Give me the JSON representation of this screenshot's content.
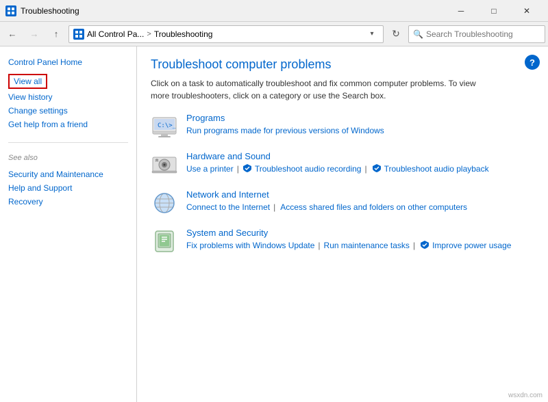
{
  "titleBar": {
    "title": "Troubleshooting",
    "minimizeLabel": "─",
    "maximizeLabel": "□",
    "closeLabel": "✕"
  },
  "addressBar": {
    "backTooltip": "Back",
    "forwardTooltip": "Forward",
    "upTooltip": "Up",
    "pathShort": "All Control Pa...",
    "pathSep": ">",
    "current": "Troubleshooting",
    "refreshLabel": "⟳",
    "searchPlaceholder": "Search Troubleshooting"
  },
  "sidebar": {
    "homeLabel": "Control Panel Home",
    "links": [
      {
        "label": "View all",
        "highlighted": true
      },
      {
        "label": "View history",
        "highlighted": false
      },
      {
        "label": "Change settings",
        "highlighted": false
      },
      {
        "label": "Get help from a friend",
        "highlighted": false
      }
    ],
    "seeAlsoLabel": "See also",
    "seeAlsoLinks": [
      "Security and Maintenance",
      "Help and Support",
      "Recovery"
    ]
  },
  "content": {
    "title": "Troubleshoot computer problems",
    "description": "Click on a task to automatically troubleshoot and fix common computer problems. To view more troubleshooters, click on a category or use the Search box.",
    "helpButtonLabel": "?",
    "categories": [
      {
        "id": "programs",
        "title": "Programs",
        "links": [
          {
            "label": "Run programs made for previous versions of Windows",
            "shield": false
          }
        ]
      },
      {
        "id": "hardware",
        "title": "Hardware and Sound",
        "links": [
          {
            "label": "Use a printer",
            "shield": false
          },
          {
            "label": "Troubleshoot audio recording",
            "shield": true
          },
          {
            "label": "Troubleshoot audio playback",
            "shield": true
          }
        ]
      },
      {
        "id": "network",
        "title": "Network and Internet",
        "links": [
          {
            "label": "Connect to the Internet",
            "shield": false
          },
          {
            "label": "Access shared files and folders on other computers",
            "shield": false
          }
        ]
      },
      {
        "id": "system",
        "title": "System and Security",
        "links": [
          {
            "label": "Fix problems with Windows Update",
            "shield": false
          },
          {
            "label": "Run maintenance tasks",
            "shield": false
          },
          {
            "label": "Improve power usage",
            "shield": true
          }
        ]
      }
    ]
  },
  "watermark": "wsxdn.com"
}
